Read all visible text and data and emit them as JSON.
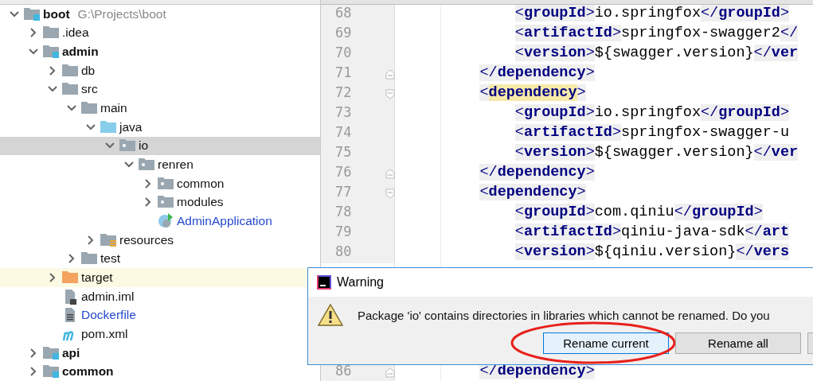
{
  "project_tree": [
    {
      "name": "boot",
      "detail": "G:\\Projects\\boot",
      "kind": "module",
      "expanded": true,
      "selected": false,
      "highlighted": false,
      "children": [
        {
          "name": ".idea",
          "kind": "folder",
          "expanded": false,
          "selected": false,
          "highlighted": false
        },
        {
          "name": "admin",
          "kind": "module",
          "expanded": true,
          "selected": false,
          "highlighted": false,
          "children": [
            {
              "name": "db",
              "kind": "folder",
              "expanded": false,
              "selected": false,
              "highlighted": false
            },
            {
              "name": "src",
              "kind": "folder",
              "expanded": true,
              "selected": false,
              "highlighted": false,
              "children": [
                {
                  "name": "main",
                  "kind": "folder",
                  "expanded": true,
                  "selected": false,
                  "highlighted": false,
                  "children": [
                    {
                      "name": "java",
                      "kind": "source-folder",
                      "expanded": true,
                      "selected": false,
                      "highlighted": false,
                      "children": [
                        {
                          "name": "io",
                          "kind": "package",
                          "expanded": true,
                          "selected": true,
                          "highlighted": false,
                          "children": [
                            {
                              "name": "renren",
                              "kind": "package",
                              "expanded": true,
                              "selected": false,
                              "highlighted": false,
                              "children": [
                                {
                                  "name": "common",
                                  "kind": "package",
                                  "expanded": false,
                                  "selected": false,
                                  "highlighted": false
                                },
                                {
                                  "name": "modules",
                                  "kind": "package",
                                  "expanded": false,
                                  "selected": false,
                                  "highlighted": false
                                },
                                {
                                  "name": "AdminApplication",
                                  "kind": "class",
                                  "added": true,
                                  "selected": false,
                                  "highlighted": false
                                }
                              ]
                            }
                          ]
                        }
                      ]
                    },
                    {
                      "name": "resources",
                      "kind": "resources-folder",
                      "expanded": false,
                      "selected": false,
                      "highlighted": false
                    }
                  ]
                },
                {
                  "name": "test",
                  "kind": "folder",
                  "expanded": false,
                  "selected": false,
                  "highlighted": false
                }
              ]
            },
            {
              "name": "target",
              "kind": "excluded-folder",
              "expanded": false,
              "selected": false,
              "highlighted": true
            },
            {
              "name": "admin.iml",
              "kind": "module-file",
              "added": false,
              "selected": false,
              "highlighted": false
            },
            {
              "name": "Dockerfile",
              "kind": "text-file",
              "added": true,
              "selected": false,
              "highlighted": false
            },
            {
              "name": "pom.xml",
              "kind": "maven-file",
              "added": false,
              "selected": false,
              "highlighted": false
            }
          ]
        },
        {
          "name": "api",
          "kind": "module",
          "expanded": false,
          "selected": false,
          "highlighted": false
        },
        {
          "name": "common",
          "kind": "module",
          "expanded": false,
          "selected": false,
          "highlighted": false
        }
      ]
    }
  ],
  "editor": {
    "lines": [
      {
        "number": "68",
        "text": "        <groupId>io.springfox</groupId>",
        "fold_start": false,
        "fold_end": false,
        "highlight": false
      },
      {
        "number": "69",
        "text": "        <artifactId>springfox-swagger2</",
        "fold_start": false,
        "fold_end": false,
        "highlight": false
      },
      {
        "number": "70",
        "text": "        <version>${swagger.version}</ver",
        "fold_start": false,
        "fold_end": false,
        "highlight": false
      },
      {
        "number": "71",
        "text": "    </dependency>",
        "fold_start": false,
        "fold_end": true,
        "highlight": false
      },
      {
        "number": "72",
        "text": "    <dependency>",
        "fold_start": true,
        "fold_end": false,
        "highlight": true
      },
      {
        "number": "73",
        "text": "        <groupId>io.springfox</groupId>",
        "fold_start": false,
        "fold_end": false,
        "highlight": false
      },
      {
        "number": "74",
        "text": "        <artifactId>springfox-swagger-u",
        "fold_start": false,
        "fold_end": false,
        "highlight": false
      },
      {
        "number": "75",
        "text": "        <version>${swagger.version}</ver",
        "fold_start": false,
        "fold_end": false,
        "highlight": false
      },
      {
        "number": "76",
        "text": "    </dependency>",
        "fold_start": false,
        "fold_end": true,
        "highlight": false
      },
      {
        "number": "77",
        "text": "    <dependency>",
        "fold_start": true,
        "fold_end": false,
        "highlight": false
      },
      {
        "number": "78",
        "text": "        <groupId>com.qiniu</groupId>",
        "fold_start": false,
        "fold_end": false,
        "highlight": false
      },
      {
        "number": "79",
        "text": "        <artifactId>qiniu-java-sdk</art",
        "fold_start": false,
        "fold_end": false,
        "highlight": false
      },
      {
        "number": "80",
        "text": "        <version>${qiniu.version}</vers",
        "fold_start": false,
        "fold_end": false,
        "highlight": false
      },
      {
        "number": "86",
        "text": "    </dependency>",
        "fold_start": false,
        "fold_end": true,
        "highlight": false
      }
    ]
  },
  "dialog": {
    "title": "Warning",
    "message": "Package 'io' contains directories in libraries which cannot be renamed. Do you",
    "buttons": [
      {
        "label": "Rename current",
        "default": true,
        "circled": true
      },
      {
        "label": "Rename all",
        "default": false,
        "circled": false
      },
      {
        "default": false,
        "circled": false
      }
    ]
  }
}
